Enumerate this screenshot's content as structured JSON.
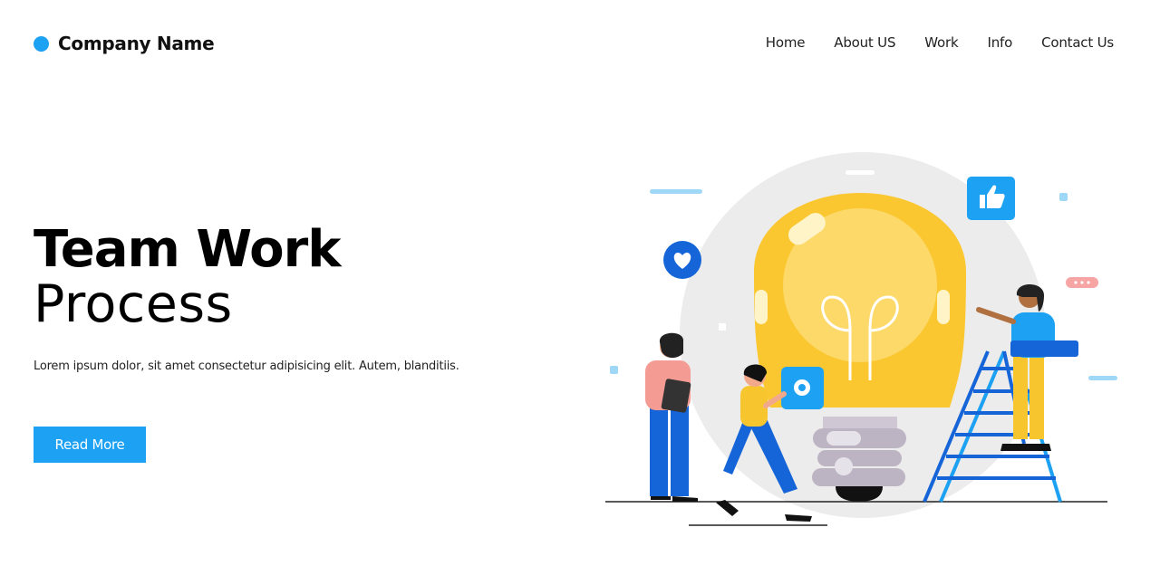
{
  "brand": {
    "name": "Company Name",
    "accent": "#1da1f2"
  },
  "nav": {
    "items": [
      "Home",
      "About US",
      "Work",
      "Info",
      "Contact Us"
    ]
  },
  "hero": {
    "title": "Team Work",
    "subtitle": "Process",
    "text": "Lorem ipsum dolor, sit amet consectetur adipisicing elit. Autem, blanditiis.",
    "button": "Read More"
  },
  "illustration": {
    "icons": [
      "light-bulb-icon",
      "thumbs-up-icon",
      "heart-icon",
      "gear-icon",
      "chat-bubble-icon",
      "ladder-icon"
    ]
  }
}
